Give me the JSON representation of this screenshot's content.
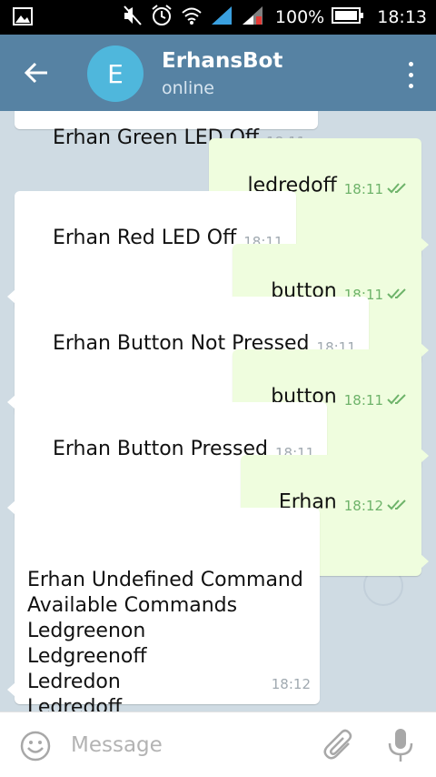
{
  "status_bar": {
    "battery_percent": "100%",
    "time": "18:13",
    "icons": [
      "gallery-icon",
      "mute-icon",
      "alarm-icon",
      "wifi-icon",
      "signal-icon",
      "signal-2-icon",
      "battery-icon"
    ]
  },
  "toolbar": {
    "avatar_letter": "E",
    "title": "ErhansBot",
    "status": "online",
    "colors": {
      "background": "#5682a3",
      "avatar": "#4fb7dc"
    }
  },
  "messages": [
    {
      "direction": "in",
      "text": "Erhan Green LED Off",
      "time": "18:11"
    },
    {
      "direction": "out",
      "text": "ledredoff",
      "time": "18:11",
      "read": true
    },
    {
      "direction": "in",
      "text": "Erhan Red LED Off",
      "time": "18:11"
    },
    {
      "direction": "out",
      "text": "button",
      "time": "18:11",
      "read": true
    },
    {
      "direction": "in",
      "text": "Erhan Button Not Pressed",
      "time": "18:11"
    },
    {
      "direction": "out",
      "text": "button",
      "time": "18:11",
      "read": true
    },
    {
      "direction": "in",
      "text": "Erhan Button Pressed",
      "time": "18:11"
    },
    {
      "direction": "out",
      "text": "Erhan",
      "time": "18:12",
      "read": true
    },
    {
      "direction": "in",
      "text": "Erhan Undefined Command\nAvailable Commands\nLedgreenon\nLedgreenoff\nLedredon\nLedredoff\nButton",
      "time": "18:12"
    }
  ],
  "input": {
    "placeholder": "Message",
    "value": ""
  },
  "colors": {
    "chat_background": "#cfdbe3",
    "incoming_bubble": "#ffffff",
    "outgoing_bubble": "#effdde",
    "read_check": "#6eb36a"
  }
}
